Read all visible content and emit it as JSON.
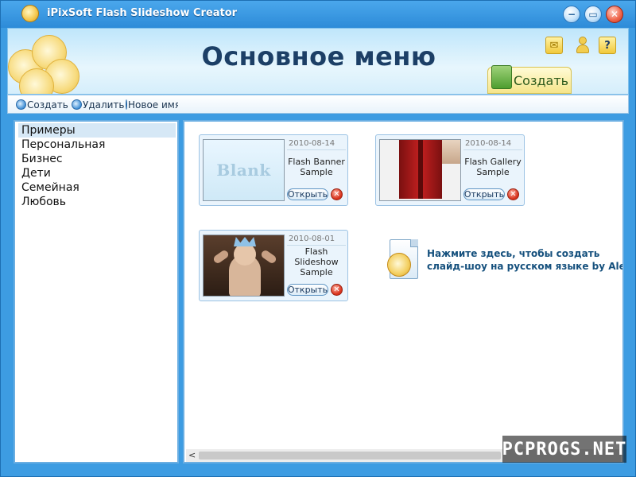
{
  "window": {
    "title": "iPixSoft Flash Slideshow Creator"
  },
  "header": {
    "title": "Основное меню",
    "create_label": "Создать"
  },
  "toolbar": {
    "create": "Создать",
    "delete": "Удалить",
    "new_name": "Новое имя"
  },
  "categories": [
    {
      "label": "Примеры",
      "selected": true
    },
    {
      "label": "Персональная"
    },
    {
      "label": "Бизнес"
    },
    {
      "label": "Дети"
    },
    {
      "label": "Семейная"
    },
    {
      "label": "Любовь"
    }
  ],
  "cards": [
    {
      "date": "2010-08-14",
      "name": "Flash Banner Sample",
      "thumb_text": "Blank",
      "open": "Открыть"
    },
    {
      "date": "2010-08-14",
      "name": "Flash Gallery Sample",
      "open": "Открыть"
    },
    {
      "date": "2010-08-01",
      "name": "Flash Slideshow Sample",
      "open": "Открыть"
    }
  ],
  "create_link": {
    "line1": "Нажмите здесь, чтобы создать",
    "line2": "слайд-шоу на русском языке by AlexYa"
  },
  "watermark": "PCPROGS.NET"
}
